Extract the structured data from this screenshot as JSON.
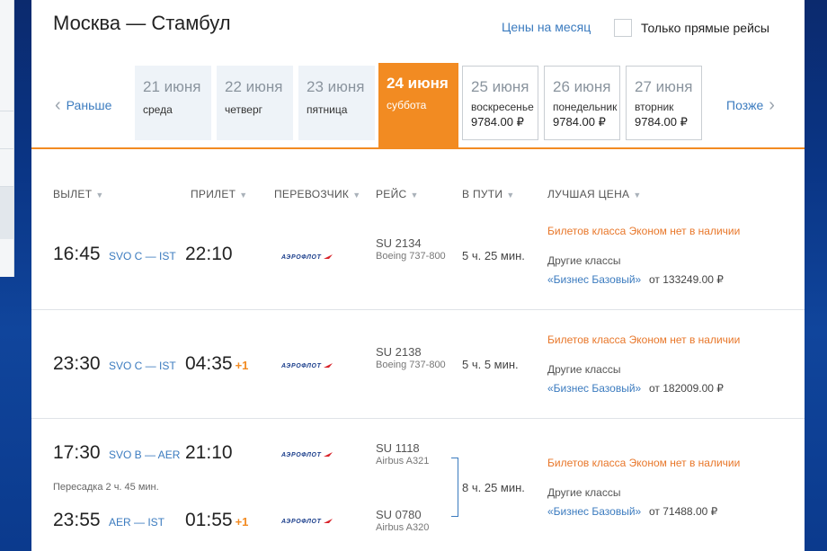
{
  "header": {
    "title": "Москва — Стамбул",
    "month_prices_link": "Цены на месяц",
    "direct_only_label": "Только прямые рейсы"
  },
  "date_nav": {
    "prev_label": "Раньше",
    "next_label": "Позже",
    "dates": [
      {
        "date": "21 июня",
        "weekday": "среда",
        "price": ""
      },
      {
        "date": "22 июня",
        "weekday": "четверг",
        "price": ""
      },
      {
        "date": "23 июня",
        "weekday": "пятница",
        "price": ""
      },
      {
        "date": "24 июня",
        "weekday": "суббота",
        "price": ""
      },
      {
        "date": "25 июня",
        "weekday": "воскресенье",
        "price": "9784.00 ₽"
      },
      {
        "date": "26 июня",
        "weekday": "понедельник",
        "price": "9784.00 ₽"
      },
      {
        "date": "27 июня",
        "weekday": "вторник",
        "price": "9784.00 ₽"
      }
    ]
  },
  "columns": {
    "departure": "ВЫЛЕТ",
    "arrival": "ПРИЛЕТ",
    "carrier": "ПЕРЕВОЗЧИК",
    "flight": "РЕЙС",
    "duration": "В ПУТИ",
    "best_price": "ЛУЧШАЯ ЦЕНА"
  },
  "carrier_logo_text": "АЭРОФЛОТ",
  "flights": [
    {
      "dep_time": "16:45",
      "route": "SVO C — IST",
      "arr_time": "22:10",
      "flight_no": "SU 2134",
      "aircraft": "Boeing 737-800",
      "duration": "5 ч. 25 мин.",
      "no_economy": "Билетов класса Эконом нет в наличии",
      "other_classes": "Другие классы",
      "class_link": "«Бизнес Базовый»",
      "price": "от 133249.00 ₽"
    },
    {
      "dep_time": "23:30",
      "route": "SVO C — IST",
      "arr_time": "04:35",
      "next_day": "+1",
      "flight_no": "SU 2138",
      "aircraft": "Boeing 737-800",
      "duration": "5 ч. 5 мин.",
      "no_economy": "Билетов класса Эконом нет в наличии",
      "other_classes": "Другие классы",
      "class_link": "«Бизнес Базовый»",
      "price": "от 182009.00 ₽"
    },
    {
      "leg1": {
        "dep_time": "17:30",
        "route": "SVO B — AER",
        "arr_time": "21:10",
        "flight_no": "SU 1118",
        "aircraft": "Airbus A321"
      },
      "transfer": "Пересадка 2 ч. 45 мин.",
      "leg2": {
        "dep_time": "23:55",
        "route": "AER — IST",
        "arr_time": "01:55",
        "next_day": "+1",
        "flight_no": "SU 0780",
        "aircraft": "Airbus A320"
      },
      "duration": "8 ч. 25 мин.",
      "no_economy": "Билетов класса Эконом нет в наличии",
      "other_classes": "Другие классы",
      "class_link": "«Бизнес Базовый»",
      "price": "от 71488.00 ₽"
    }
  ],
  "colors": {
    "accent": "#f28b22",
    "link": "#3b7bbf",
    "background": "#0a3585"
  }
}
